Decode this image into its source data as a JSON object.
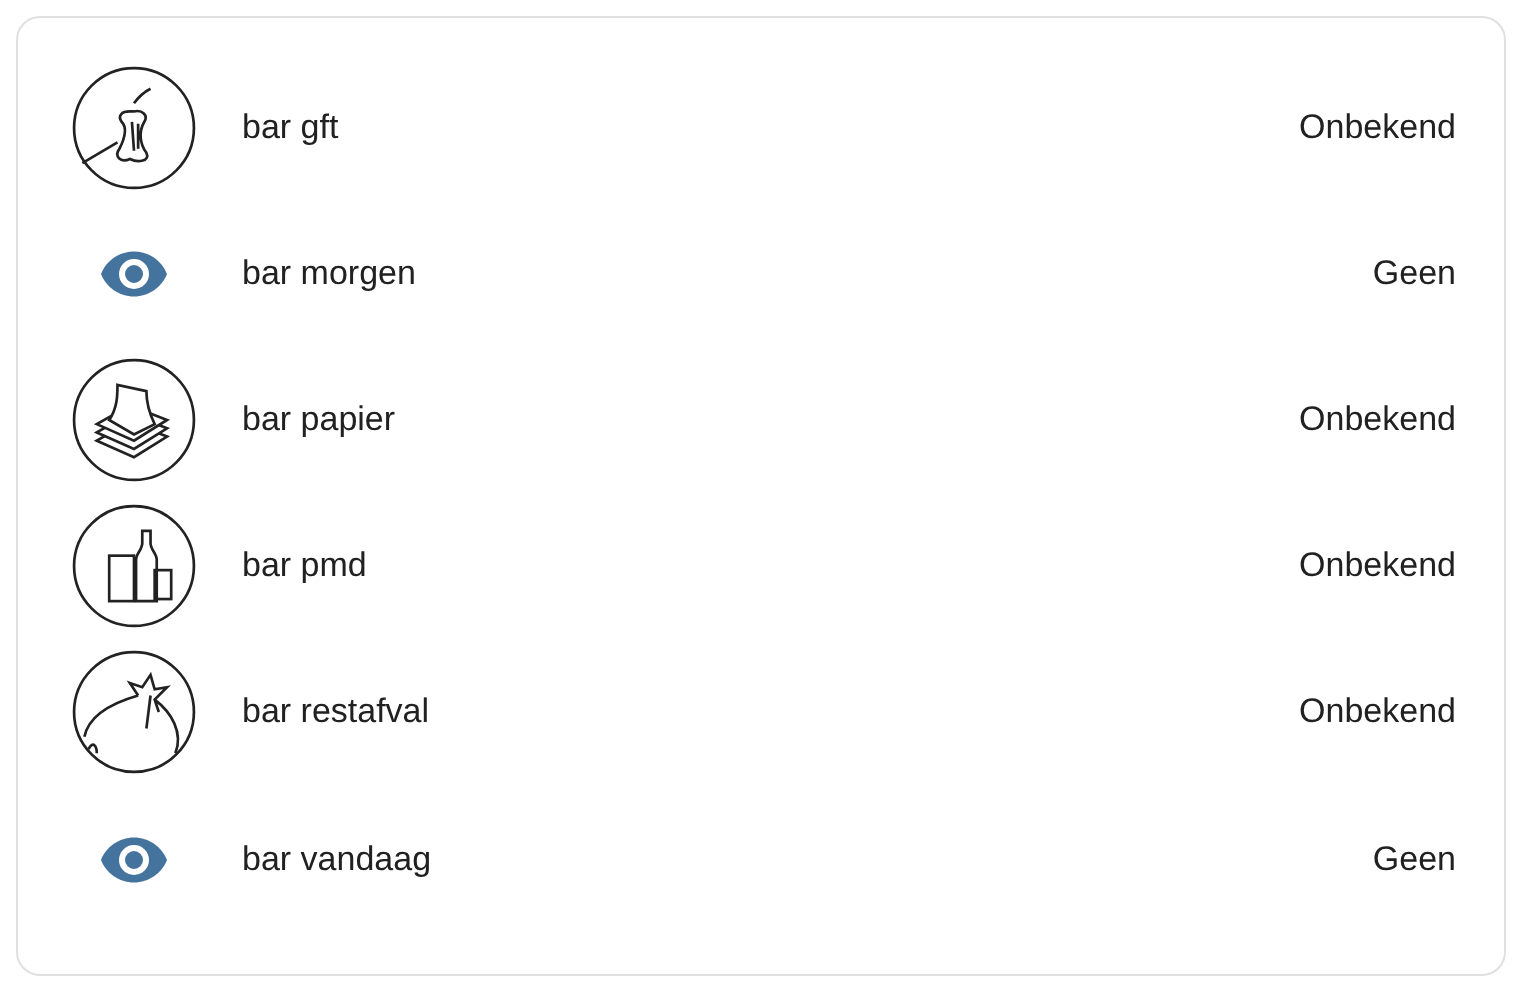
{
  "rows": [
    {
      "kind": "apple",
      "name": "bar gft",
      "state": "Onbekend"
    },
    {
      "kind": "eye",
      "name": "bar morgen",
      "state": "Geen"
    },
    {
      "kind": "paper",
      "name": "bar papier",
      "state": "Onbekend"
    },
    {
      "kind": "bottles",
      "name": "bar pmd",
      "state": "Onbekend"
    },
    {
      "kind": "bag",
      "name": "bar restafval",
      "state": "Onbekend"
    },
    {
      "kind": "eye",
      "name": "bar vandaag",
      "state": "Geen"
    }
  ]
}
